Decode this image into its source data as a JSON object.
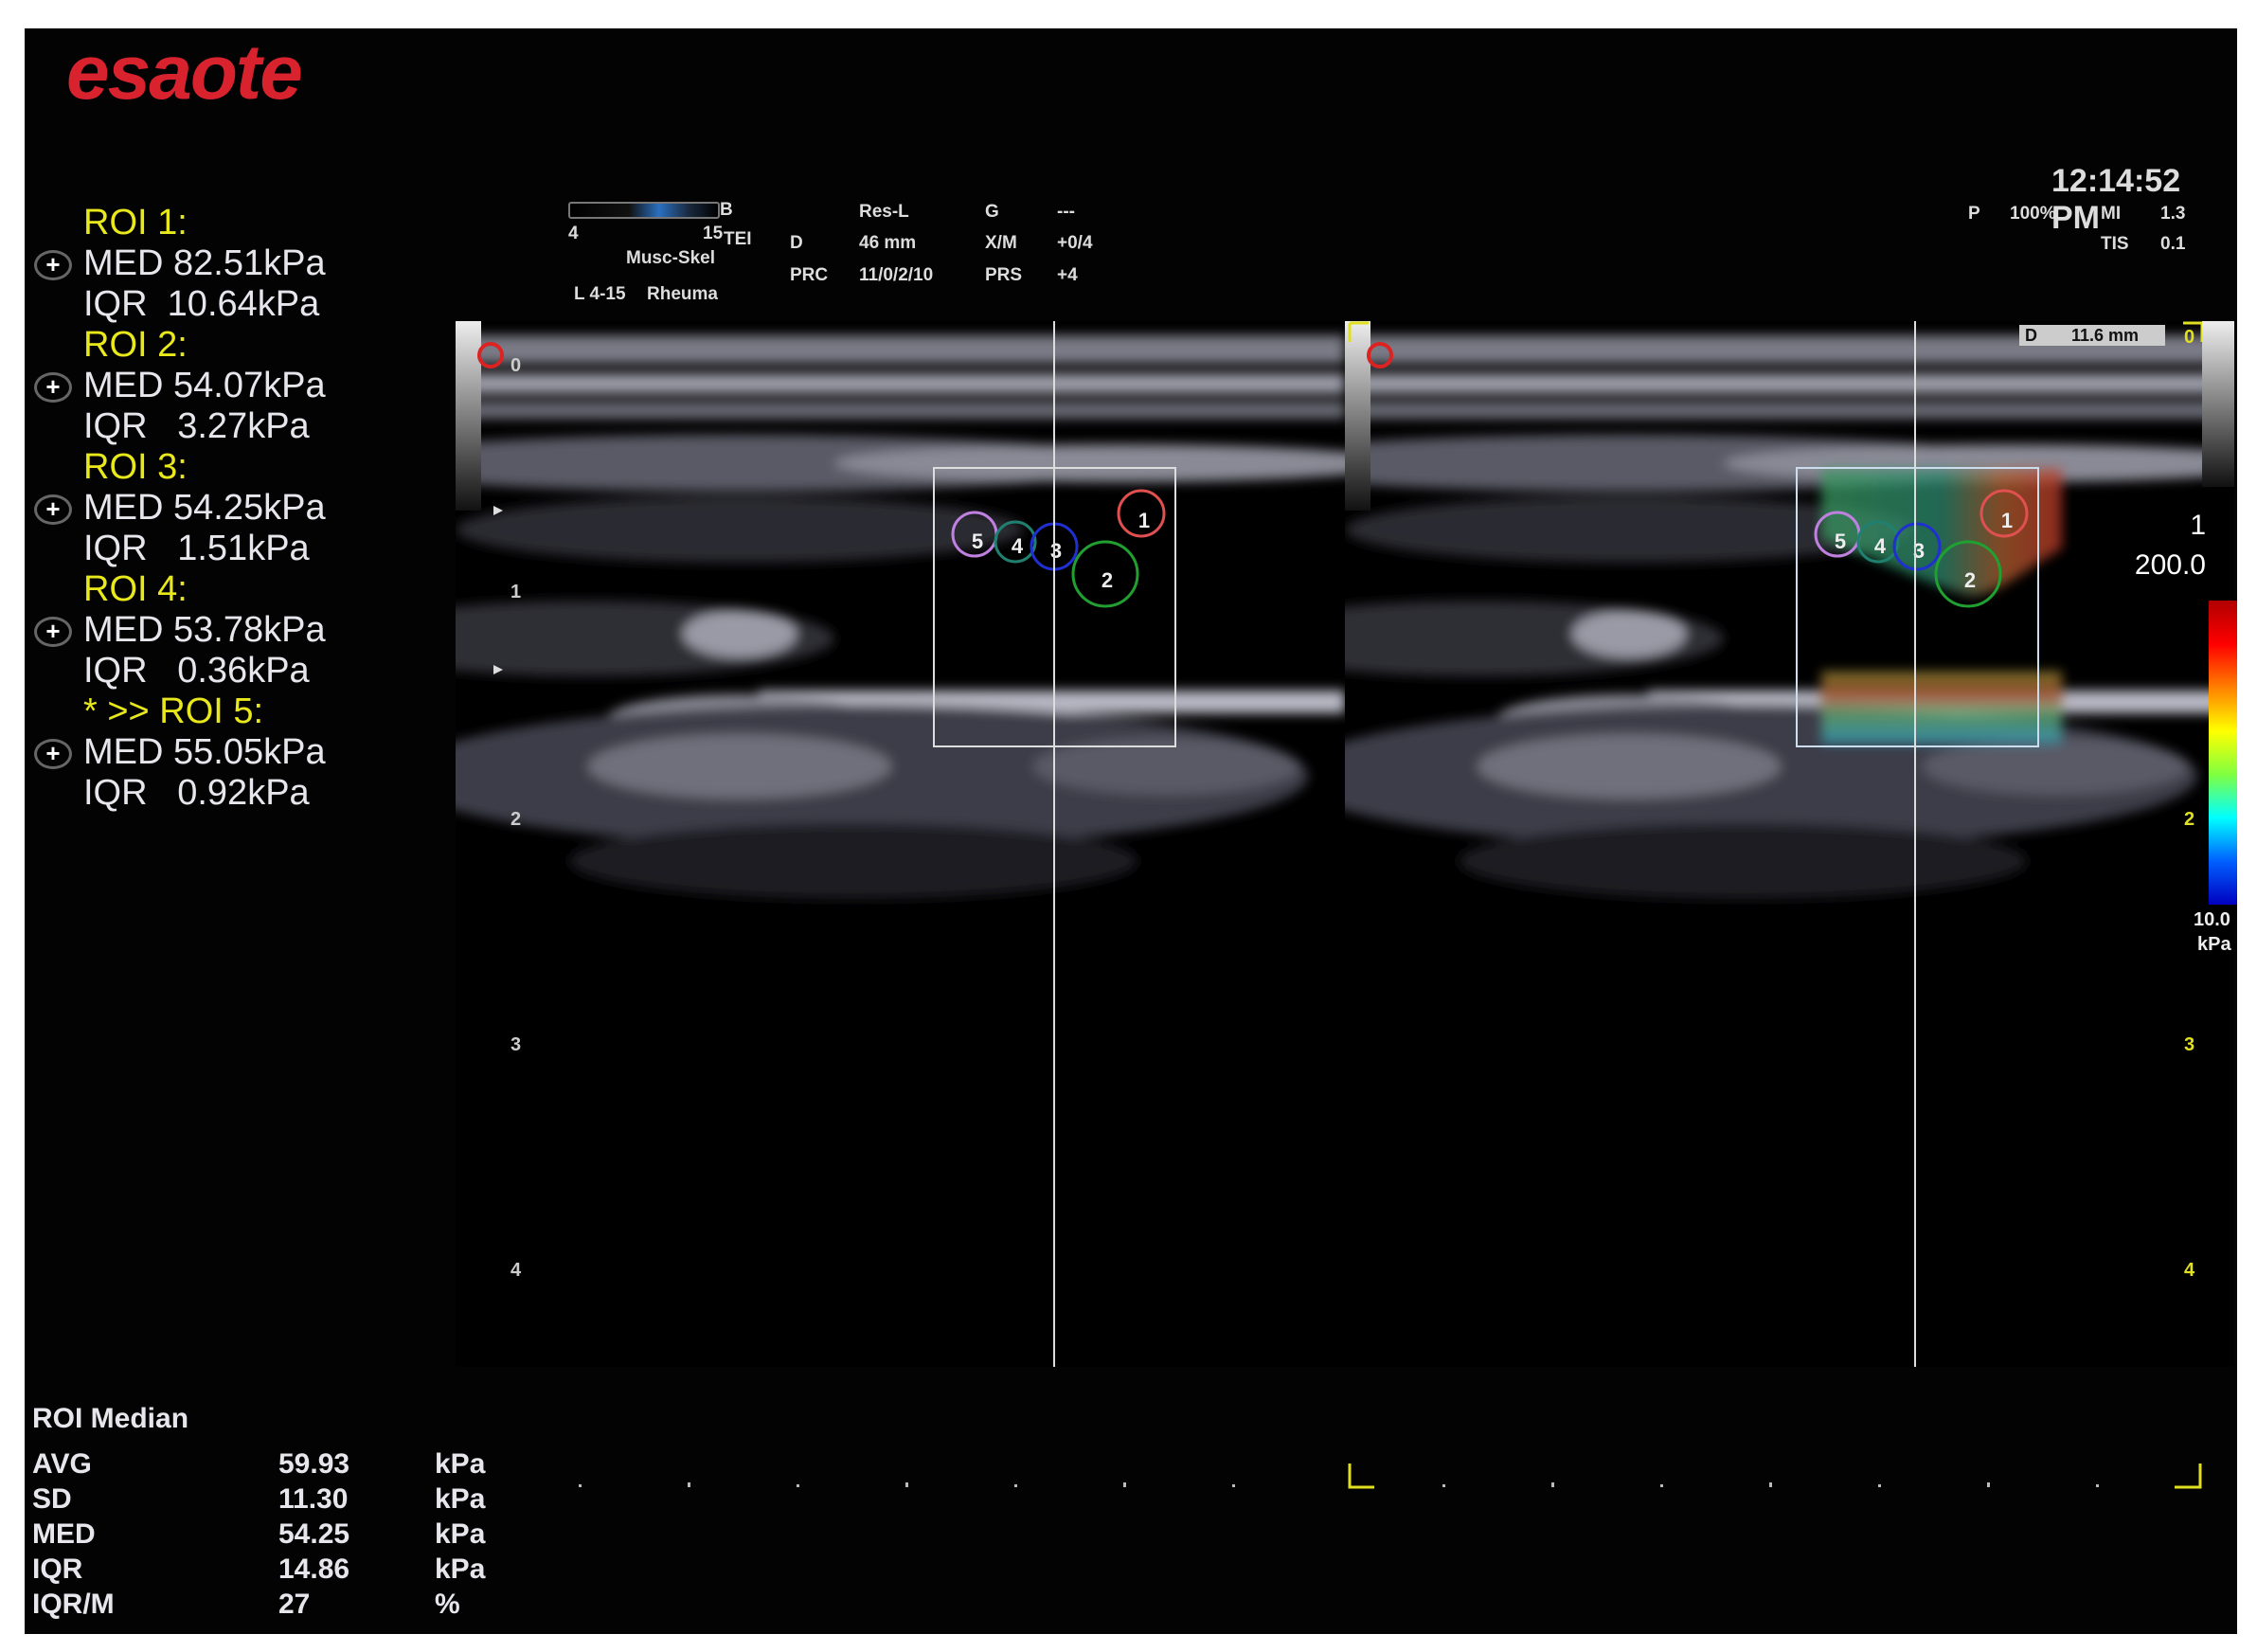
{
  "brand": {
    "logo": "esaote"
  },
  "rois": [
    {
      "title": "ROI 1:",
      "med": "MED 82.51kPa",
      "iqr": "IQR  10.64kPa"
    },
    {
      "title": "ROI 2:",
      "med": "MED 54.07kPa",
      "iqr": "IQR   3.27kPa"
    },
    {
      "title": "ROI 3:",
      "med": "MED 54.25kPa",
      "iqr": "IQR   1.51kPa"
    },
    {
      "title": "ROI 4:",
      "med": "MED 53.78kPa",
      "iqr": "IQR   0.36kPa"
    },
    {
      "title": "* >> ROI 5:",
      "med": "MED 55.05kPa",
      "iqr": "IQR   0.92kPa"
    }
  ],
  "header": {
    "freq_min": "4",
    "freq_max": "15",
    "mode": "B",
    "tei": "TEI",
    "preset": "Musc-Skel",
    "probe": "L 4-15",
    "app": "Rheuma",
    "res": "Res-L",
    "g_label": "G",
    "g_value": "---",
    "d_label": "D",
    "d_value": "46 mm",
    "xm_label": "X/M",
    "xm_value": "+0/4",
    "prc_label": "PRC",
    "prc_value": "11/0/2/10",
    "prs_label": "PRS",
    "prs_value": "+4"
  },
  "time": "12:14:52 PM",
  "power": {
    "p_label": "P",
    "p_value": "100%",
    "mi_label": "MI",
    "mi_value": "1.3",
    "tis_label": "TIS",
    "tis_value": "0.1"
  },
  "measure": {
    "label": "D",
    "value": "11.6 mm"
  },
  "depth_ticks": [
    "0",
    "1",
    "2",
    "3",
    "4"
  ],
  "roi_numbers": [
    "1",
    "2",
    "3",
    "4",
    "5"
  ],
  "colorbar": {
    "frame": "1",
    "max": "200.0",
    "min": "10.0",
    "unit": "kPa",
    "colors": [
      "#b00000",
      "#ff0000",
      "#ff8000",
      "#ffff00",
      "#80ff40",
      "#00ffff",
      "#0060ff",
      "#0000c0"
    ]
  },
  "stats": {
    "title": "ROI Median",
    "rows": [
      {
        "label": "AVG",
        "value": "59.93",
        "unit": "kPa"
      },
      {
        "label": "SD",
        "value": "11.30",
        "unit": "kPa"
      },
      {
        "label": "MED",
        "value": "54.25",
        "unit": "kPa"
      },
      {
        "label": "IQR",
        "value": "14.86",
        "unit": "kPa"
      },
      {
        "label": "IQR/M",
        "value": "27",
        "unit": "%"
      }
    ]
  }
}
